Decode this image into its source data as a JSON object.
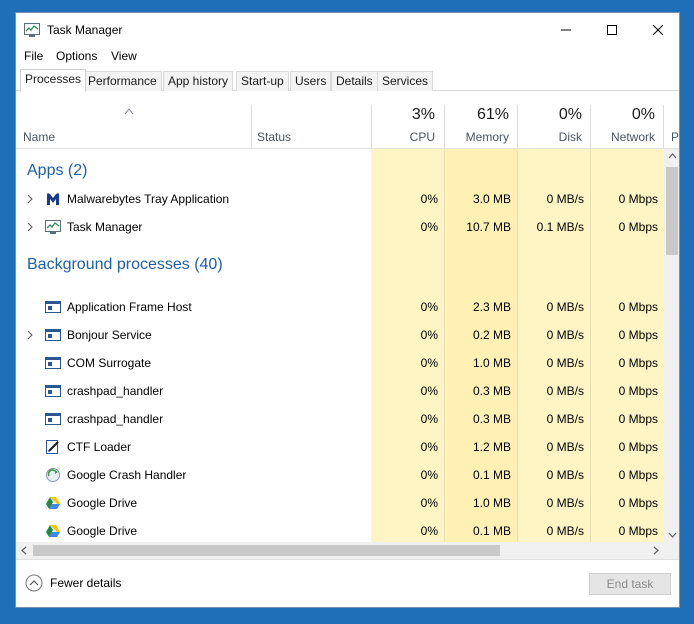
{
  "window": {
    "title": "Task Manager"
  },
  "menu": [
    "File",
    "Options",
    "View"
  ],
  "tabs": [
    "Processes",
    "Performance",
    "App history",
    "Start-up",
    "Users",
    "Details",
    "Services"
  ],
  "columns": {
    "name": "Name",
    "status": "Status",
    "cpu": {
      "label": "CPU",
      "percent": "3%"
    },
    "memory": {
      "label": "Memory",
      "percent": "61%"
    },
    "disk": {
      "label": "Disk",
      "percent": "0%"
    },
    "network": {
      "label": "Network",
      "percent": "0%"
    },
    "power": {
      "label": "P"
    }
  },
  "groups": {
    "apps": {
      "title": "Apps (2)"
    },
    "background": {
      "title": "Background processes (40)"
    }
  },
  "apps": [
    {
      "name": "Malwarebytes Tray Application",
      "cpu": "0%",
      "memory": "3.0 MB",
      "disk": "0 MB/s",
      "network": "0 Mbps",
      "icon": "malwarebytes-icon"
    },
    {
      "name": "Task Manager",
      "cpu": "0%",
      "memory": "10.7 MB",
      "disk": "0.1 MB/s",
      "network": "0 Mbps",
      "icon": "task-manager-icon"
    }
  ],
  "background": [
    {
      "name": "Application Frame Host",
      "cpu": "0%",
      "memory": "2.3 MB",
      "disk": "0 MB/s",
      "network": "0 Mbps",
      "icon": "window-icon"
    },
    {
      "name": "Bonjour Service",
      "cpu": "0%",
      "memory": "0.2 MB",
      "disk": "0 MB/s",
      "network": "0 Mbps",
      "icon": "window-icon"
    },
    {
      "name": "COM Surrogate",
      "cpu": "0%",
      "memory": "1.0 MB",
      "disk": "0 MB/s",
      "network": "0 Mbps",
      "icon": "window-icon"
    },
    {
      "name": "crashpad_handler",
      "cpu": "0%",
      "memory": "0.3 MB",
      "disk": "0 MB/s",
      "network": "0 Mbps",
      "icon": "window-icon"
    },
    {
      "name": "crashpad_handler",
      "cpu": "0%",
      "memory": "0.3 MB",
      "disk": "0 MB/s",
      "network": "0 Mbps",
      "icon": "window-icon"
    },
    {
      "name": "CTF Loader",
      "cpu": "0%",
      "memory": "1.2 MB",
      "disk": "0 MB/s",
      "network": "0 Mbps",
      "icon": "pen-icon"
    },
    {
      "name": "Google Crash Handler",
      "cpu": "0%",
      "memory": "0.1 MB",
      "disk": "0 MB/s",
      "network": "0 Mbps",
      "icon": "google-update-icon"
    },
    {
      "name": "Google Drive",
      "cpu": "0%",
      "memory": "1.0 MB",
      "disk": "0 MB/s",
      "network": "0 Mbps",
      "icon": "google-drive-icon"
    },
    {
      "name": "Google Drive",
      "cpu": "0%",
      "memory": "0.1 MB",
      "disk": "0 MB/s",
      "network": "0 Mbps",
      "icon": "google-drive-icon"
    }
  ],
  "footer": {
    "fewer_details": "Fewer details",
    "end_task": "End task"
  },
  "colors": {
    "accent": "#1f5fa5",
    "cell_light": "#fff4c4",
    "cell_medium": "#fff0b4",
    "header_label": "#4a5560"
  }
}
